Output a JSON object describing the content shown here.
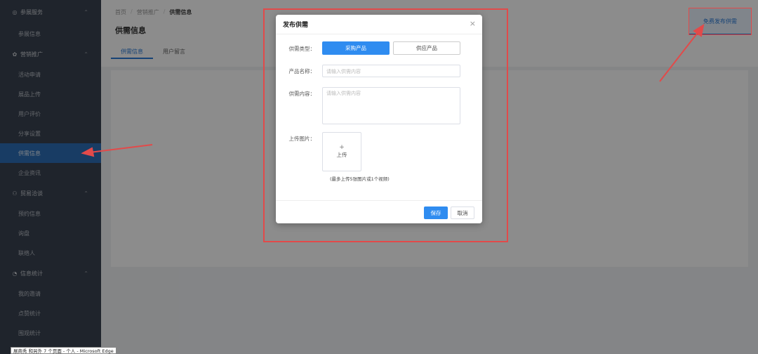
{
  "sidebar": {
    "groups": [
      {
        "label": "参展服务",
        "icon": "settings-icon",
        "icon_glyph": "◎",
        "chevron": "⌃",
        "items": [
          {
            "label": "参展信息"
          }
        ]
      },
      {
        "label": "营销推广",
        "icon": "marketing-icon",
        "icon_glyph": "✿",
        "chevron": "⌃",
        "items": [
          {
            "label": "活动申请"
          },
          {
            "label": "展品上传"
          },
          {
            "label": "用户评价"
          },
          {
            "label": "分享设置"
          },
          {
            "label": "供需信息",
            "active": true
          },
          {
            "label": "企业资讯"
          }
        ]
      },
      {
        "label": "贸易洽谈",
        "icon": "user-icon",
        "icon_glyph": "⚇",
        "chevron": "⌃",
        "items": [
          {
            "label": "预约信息"
          },
          {
            "label": "询盘"
          },
          {
            "label": "联络人"
          }
        ]
      },
      {
        "label": "信息统计",
        "icon": "stats-icon",
        "icon_glyph": "◔",
        "chevron": "⌃",
        "items": [
          {
            "label": "我的邀请"
          },
          {
            "label": "点赞统计"
          },
          {
            "label": "围观统计"
          }
        ]
      }
    ]
  },
  "breadcrumb": {
    "home": "首页",
    "section": "营销推广",
    "current": "供需信息"
  },
  "page": {
    "title": "供需信息",
    "tabs": [
      {
        "label": "供需信息",
        "active": true
      },
      {
        "label": "用户留言"
      }
    ],
    "publish_button": "免费发布供需"
  },
  "modal": {
    "title": "发布供需",
    "close_glyph": "×",
    "type_label": "供需类型：",
    "type_options": [
      "采购产品",
      "供应产品"
    ],
    "name_label": "产品名称：",
    "name_placeholder": "请输入供需内容",
    "content_label": "供需内容：",
    "content_placeholder": "请输入供需内容",
    "image_label": "上传图片：",
    "upload_plus": "+",
    "upload_text": "上传",
    "upload_hint": "(最多上传5张图片或1个视频)",
    "save": "保存",
    "cancel": "取消"
  },
  "tooltip": "展商秀 和另外 7 个页面 - 个人 - Microsoft Edge",
  "colors": {
    "accent": "#2f8cf0",
    "annotation": "#e24a4a",
    "sidebar": "#3a4250",
    "sidebar_active": "#2d6db6"
  }
}
